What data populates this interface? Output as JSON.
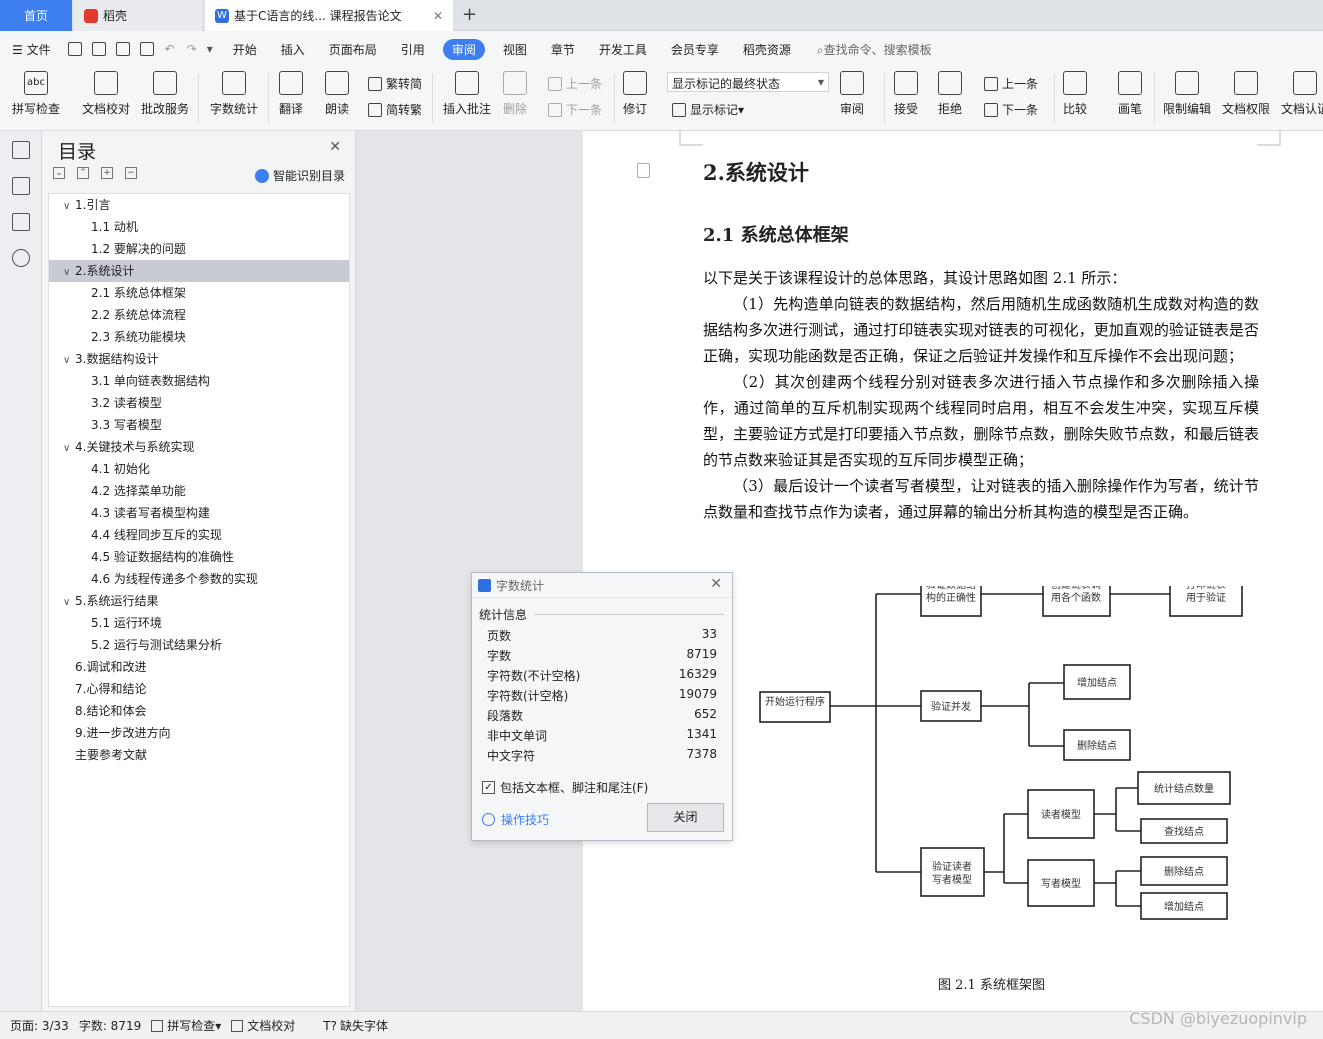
{
  "tabs": {
    "home": "首页",
    "daoke": "稻壳",
    "doc": "基于C语言的线... 课程报告论文"
  },
  "menu": {
    "file": "文件",
    "items": [
      "开始",
      "插入",
      "页面布局",
      "引用",
      "审阅",
      "视图",
      "章节",
      "开发工具",
      "会员专享",
      "稻壳资源"
    ],
    "active": "审阅",
    "search": "查找命令、搜索模板"
  },
  "ribbon": {
    "spell": "拼写检查",
    "proof": "文档校对",
    "annot": "批改服务",
    "wordcount": "字数统计",
    "translate": "翻译",
    "read": "朗读",
    "trad": "繁转简",
    "simp": "简转繁",
    "insert_comment": "插入批注",
    "delete": "删除",
    "prev": "上一条",
    "next": "下一条",
    "revise": "修订",
    "state": "显示标记的最终状态",
    "show_marks": "显示标记",
    "review": "审阅",
    "accept": "接受",
    "reject": "拒绝",
    "prev2": "上一条",
    "next2": "下一条",
    "compare": "比较",
    "pen": "画笔",
    "restrict": "限制编辑",
    "perm": "文档权限",
    "cert": "文档认证"
  },
  "toc": {
    "title": "目录",
    "smart": "智能识别目录",
    "items": [
      {
        "t": "1.引言",
        "lvl": 1,
        "open": true
      },
      {
        "t": "1.1 动机",
        "lvl": 2
      },
      {
        "t": "1.2  要解决的问题",
        "lvl": 2
      },
      {
        "t": "2.系统设计",
        "lvl": 1,
        "open": true,
        "sel": true
      },
      {
        "t": "2.1 系统总体框架",
        "lvl": 2
      },
      {
        "t": "2.2  系统总体流程",
        "lvl": 2
      },
      {
        "t": "2.3  系统功能模块",
        "lvl": 2
      },
      {
        "t": "3.数据结构设计",
        "lvl": 1,
        "open": true
      },
      {
        "t": "3.1 单向链表数据结构",
        "lvl": 2
      },
      {
        "t": "3.2 读者模型",
        "lvl": 2
      },
      {
        "t": "3.3 写者模型",
        "lvl": 2
      },
      {
        "t": "4.关键技术与系统实现",
        "lvl": 1,
        "open": true
      },
      {
        "t": "4.1 初始化",
        "lvl": 2
      },
      {
        "t": "4.2 选择菜单功能",
        "lvl": 2
      },
      {
        "t": "4.3 读者写者模型构建",
        "lvl": 2
      },
      {
        "t": "4.4 线程同步互斥的实现",
        "lvl": 2
      },
      {
        "t": "4.5 验证数据结构的准确性",
        "lvl": 2
      },
      {
        "t": "4.6 为线程传递多个参数的实现",
        "lvl": 2
      },
      {
        "t": "5.系统运行结果",
        "lvl": 1,
        "open": true
      },
      {
        "t": "5.1 运行环境",
        "lvl": 2
      },
      {
        "t": "5.2 运行与测试结果分析",
        "lvl": 2
      },
      {
        "t": "6.调试和改进",
        "lvl": 1
      },
      {
        "t": "7.心得和结论",
        "lvl": 1
      },
      {
        "t": "8.结论和体会",
        "lvl": 1
      },
      {
        "t": "9.进一步改进方向",
        "lvl": 1
      },
      {
        "t": "主要参考文献",
        "lvl": 1
      }
    ]
  },
  "doc": {
    "h1": "2.系统设计",
    "h2": "2.1 系统总体框架",
    "paras": [
      {
        "t": "以下是关于该课程设计的总体思路，其设计思路如图 2.1 所示：",
        "ind": false
      },
      {
        "t": "（1）先构造单向链表的数据结构，然后用随机生成函数随机生成数对构造的数据结构多次进行测试，通过打印链表实现对链表的可视化，更加直观的验证链表是否正确，实现功能函数是否正确，保证之后验证并发操作和互斥操作不会出现问题；",
        "ind": true
      },
      {
        "t": "（2）其次创建两个线程分别对链表多次进行插入节点操作和多次删除插入操作，通过简单的互斥机制实现两个线程同时启用，相互不会发生冲突，实现互斥模型，主要验证方式是打印要插入节点数，删除节点数，删除失败节点数，和最后链表的节点数来验证其是否实现的互斥同步模型正确；",
        "ind": true
      },
      {
        "t": "（3）最后设计一个读者写者模型，让对链表的插入删除操作作为写者，统计节点数量和查找节点作为读者，通过屏幕的输出分析其构造的模型是否正确。",
        "ind": true
      }
    ],
    "caption": "图 2.1  系统框架图",
    "diagram": {
      "start": "开始运行程序",
      "n1": "验证数据结构的正确性",
      "n2": "创建链表调用各个函数",
      "n3": "打印链表用于验证",
      "n4": "验证并发",
      "n5": "增加结点",
      "n6": "删除结点",
      "n7": "验证读者写者模型",
      "n8": "读者模型",
      "n9": "写者模型",
      "n10": "统计结点数量",
      "n11": "查找结点",
      "n12": "删除结点",
      "n13": "增加结点"
    }
  },
  "dialog": {
    "title": "字数统计",
    "section": "统计信息",
    "stats": [
      {
        "k": "页数",
        "v": "33"
      },
      {
        "k": "字数",
        "v": "8719"
      },
      {
        "k": "字符数(不计空格)",
        "v": "16329"
      },
      {
        "k": "字符数(计空格)",
        "v": "19079"
      },
      {
        "k": "段落数",
        "v": "652"
      },
      {
        "k": "非中文单词",
        "v": "1341"
      },
      {
        "k": "中文字符",
        "v": "7378"
      }
    ],
    "include": "包括文本框、脚注和尾注(F)",
    "tips": "操作技巧",
    "close": "关闭"
  },
  "status": {
    "page": "页面: 3/33",
    "words": "字数: 8719",
    "spell": "拼写检查",
    "proof": "文档校对",
    "font": "缺失字体"
  },
  "watermark": "CSDN @biyezuopinvip"
}
